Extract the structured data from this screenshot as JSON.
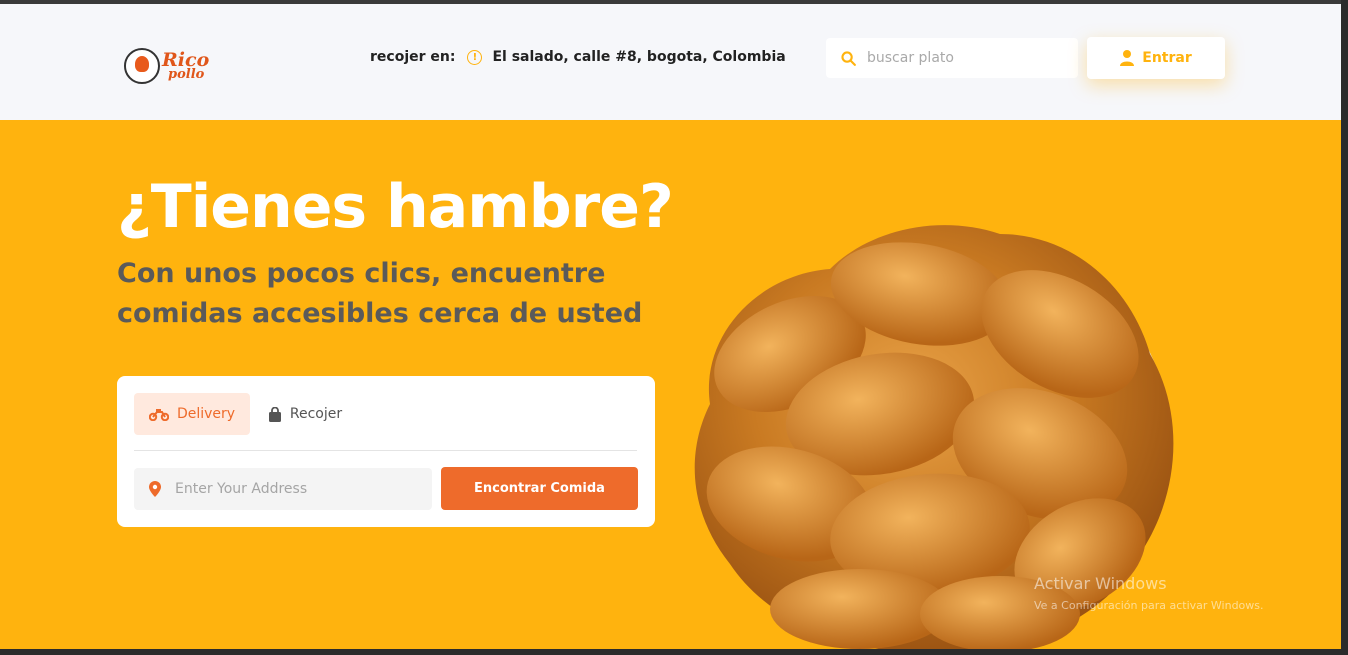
{
  "brand": {
    "logo_line1": "Rico",
    "logo_line2": "pollo",
    "primary_color": "#ffb30e",
    "accent_color": "#ee6b2b"
  },
  "header": {
    "pickup_label": "recojer en:",
    "pickup_address": "El salado, calle #8, bogota, Colombia",
    "search_placeholder": "buscar plato",
    "login_label": "Entrar"
  },
  "hero": {
    "title": "¿Tienes hambre?",
    "subtitle_line1": "Con unos pocos clics, encuentre",
    "subtitle_line2": "comidas accesibles cerca de usted",
    "tabs": [
      {
        "label": "Delivery",
        "icon": "motorcycle-icon",
        "active": true
      },
      {
        "label": "Recojer",
        "icon": "shopping-bag-icon",
        "active": false
      }
    ],
    "address_placeholder": "Enter Your Address",
    "find_button": "Encontrar Comida"
  },
  "watermark": {
    "line1": "Activar Windows",
    "line2": "Ve a Configuración para activar Windows."
  }
}
